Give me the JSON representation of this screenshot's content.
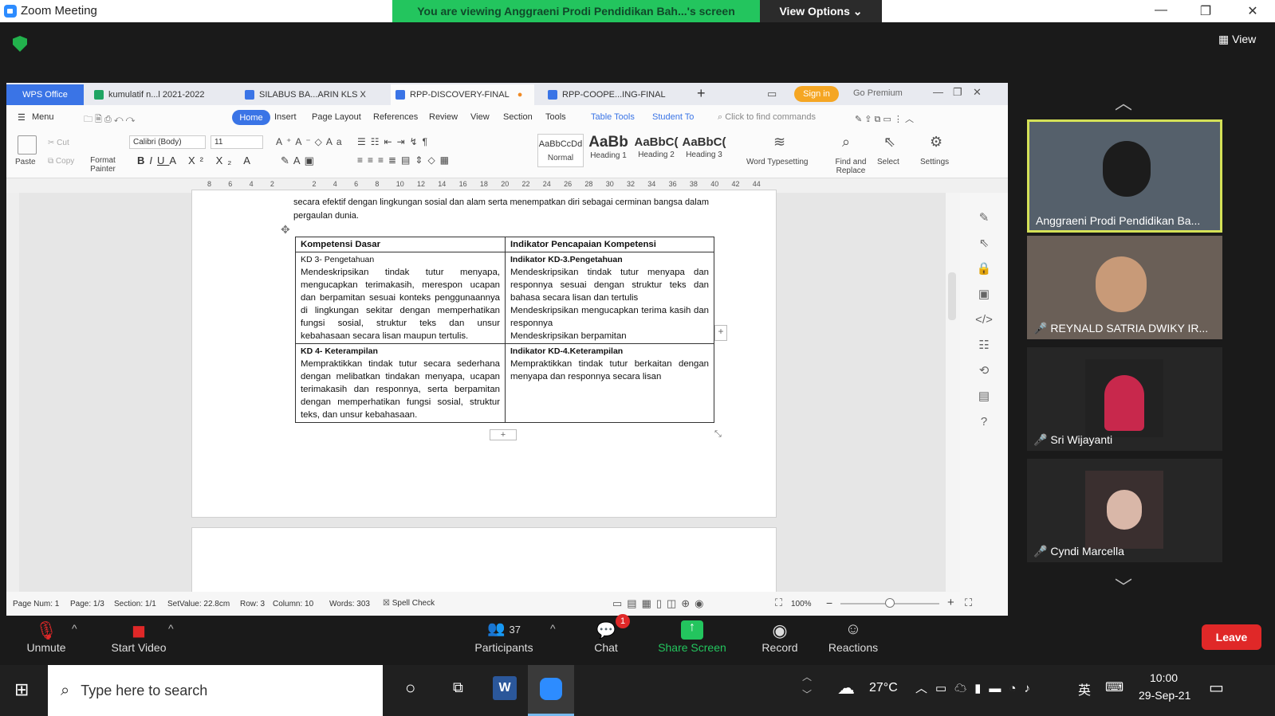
{
  "zoom": {
    "window_title": "Zoom Meeting",
    "banner": "You are viewing Anggraeni Prodi Pendidikan Bah...'s screen",
    "view_options": "View Options",
    "view": "View"
  },
  "wps": {
    "tabs": [
      "WPS Office",
      "kumulatif n...l 2021-2022",
      "SILABUS BA...ARIN KLS X",
      "RPP-DISCOVERY-FINAL",
      "RPP-COOPE...ING-FINAL"
    ],
    "sign_in": "Sign in",
    "go_premium": "Go Premium",
    "menus": [
      "Menu",
      "Home",
      "Insert",
      "Page Layout",
      "References",
      "Review",
      "View",
      "Section",
      "Tools",
      "Table Tools",
      "Student To"
    ],
    "find_commands": "Click to find commands",
    "clipboard": {
      "paste": "Paste",
      "cut": "Cut",
      "copy": "Copy",
      "format_painter": "Format Painter"
    },
    "font": {
      "name": "Calibri (Body)",
      "size": "11"
    },
    "styles": [
      {
        "preview": "AaBbCcDd",
        "label": "Normal"
      },
      {
        "preview": "AaBb",
        "label": "Heading 1"
      },
      {
        "preview": "AaBbC(",
        "label": "Heading 2"
      },
      {
        "preview": "AaBbC(",
        "label": "Heading 3"
      }
    ],
    "tools": [
      "Word Typesetting",
      "Find and Replace",
      "Select",
      "Settings"
    ],
    "ruler": [
      "8",
      "6",
      "4",
      "2",
      "",
      "2",
      "4",
      "6",
      "8",
      "10",
      "12",
      "14",
      "16",
      "18",
      "20",
      "22",
      "24",
      "26",
      "28",
      "30",
      "32",
      "34",
      "36",
      "38",
      "40",
      "42",
      "44"
    ],
    "doc": {
      "intro_1": "secara efektif dengan lingkungan sosial dan alam serta menempatkan diri sebagai cerminan bangsa dalam",
      "intro_2": "pergaulan dunia.",
      "table": {
        "header": [
          "Kompetensi Dasar",
          "Indikator Pencapaian Kompetensi"
        ],
        "kd3_title": "KD 3- Pengetahuan",
        "kd3_text": "Mendeskripsikan tindak tutur menyapa, mengucapkan terimakasih, merespon ucapan dan berpamitan sesuai konteks penggunaannya di lingkungan sekitar dengan memperhatikan fungsi sosial, struktur teks dan unsur kebahasaan secara lisan maupun tertulis.",
        "ikd3_title": "Indikator KD-3.Pengetahuan",
        "ikd3_text_1": "Mendeskripsikan tindak tutur menyapa dan responnya sesuai dengan struktur teks dan bahasa secara lisan dan tertulis",
        "ikd3_text_2": "Mendeskripsikan mengucapkan terima kasih dan responnya",
        "ikd3_text_3": "Mendeskripsikan berpamitan",
        "kd4_title": "KD 4- Keterampilan",
        "kd4_text": "Mempraktikkan tindak tutur secara sederhana dengan melibatkan tindakan menyapa, ucapan terimakasih dan responnya, serta berpamitan dengan memperhatikan fungsi sosial, struktur teks, dan unsur kebahasaan.",
        "ikd4_title": "Indikator KD-4.Keterampilan",
        "ikd4_text": "Mempraktikkan tindak tutur berkaitan dengan menyapa dan responnya secara lisan"
      }
    },
    "status": {
      "page_num": "Page Num: 1",
      "page": "Page: 1/3",
      "section": "Section: 1/1",
      "setvalue": "SetValue: 22.8cm",
      "row": "Row: 3",
      "column": "Column: 10",
      "words": "Words: 303",
      "spell": "Spell Check",
      "zoom": "100%"
    }
  },
  "participants_gallery": [
    "Anggraeni Prodi Pendidikan Ba...",
    "REYNALD SATRIA DWIKY IR...",
    "Sri Wijayanti",
    "Cyndi Marcella"
  ],
  "toolbar": {
    "unmute": "Unmute",
    "start_video": "Start Video",
    "participants": "Participants",
    "participants_count": "37",
    "chat": "Chat",
    "chat_badge": "1",
    "share_screen": "Share Screen",
    "record": "Record",
    "reactions": "Reactions",
    "leave": "Leave"
  },
  "taskbar": {
    "search_placeholder": "Type here to search",
    "temperature": "27°C",
    "ime": "英",
    "time": "10:00",
    "date": "29-Sep-21"
  },
  "colors": {
    "accent": "#2d8cff",
    "banner": "#23c55e",
    "leave": "#e02828",
    "active_speaker": "#d4e157"
  }
}
